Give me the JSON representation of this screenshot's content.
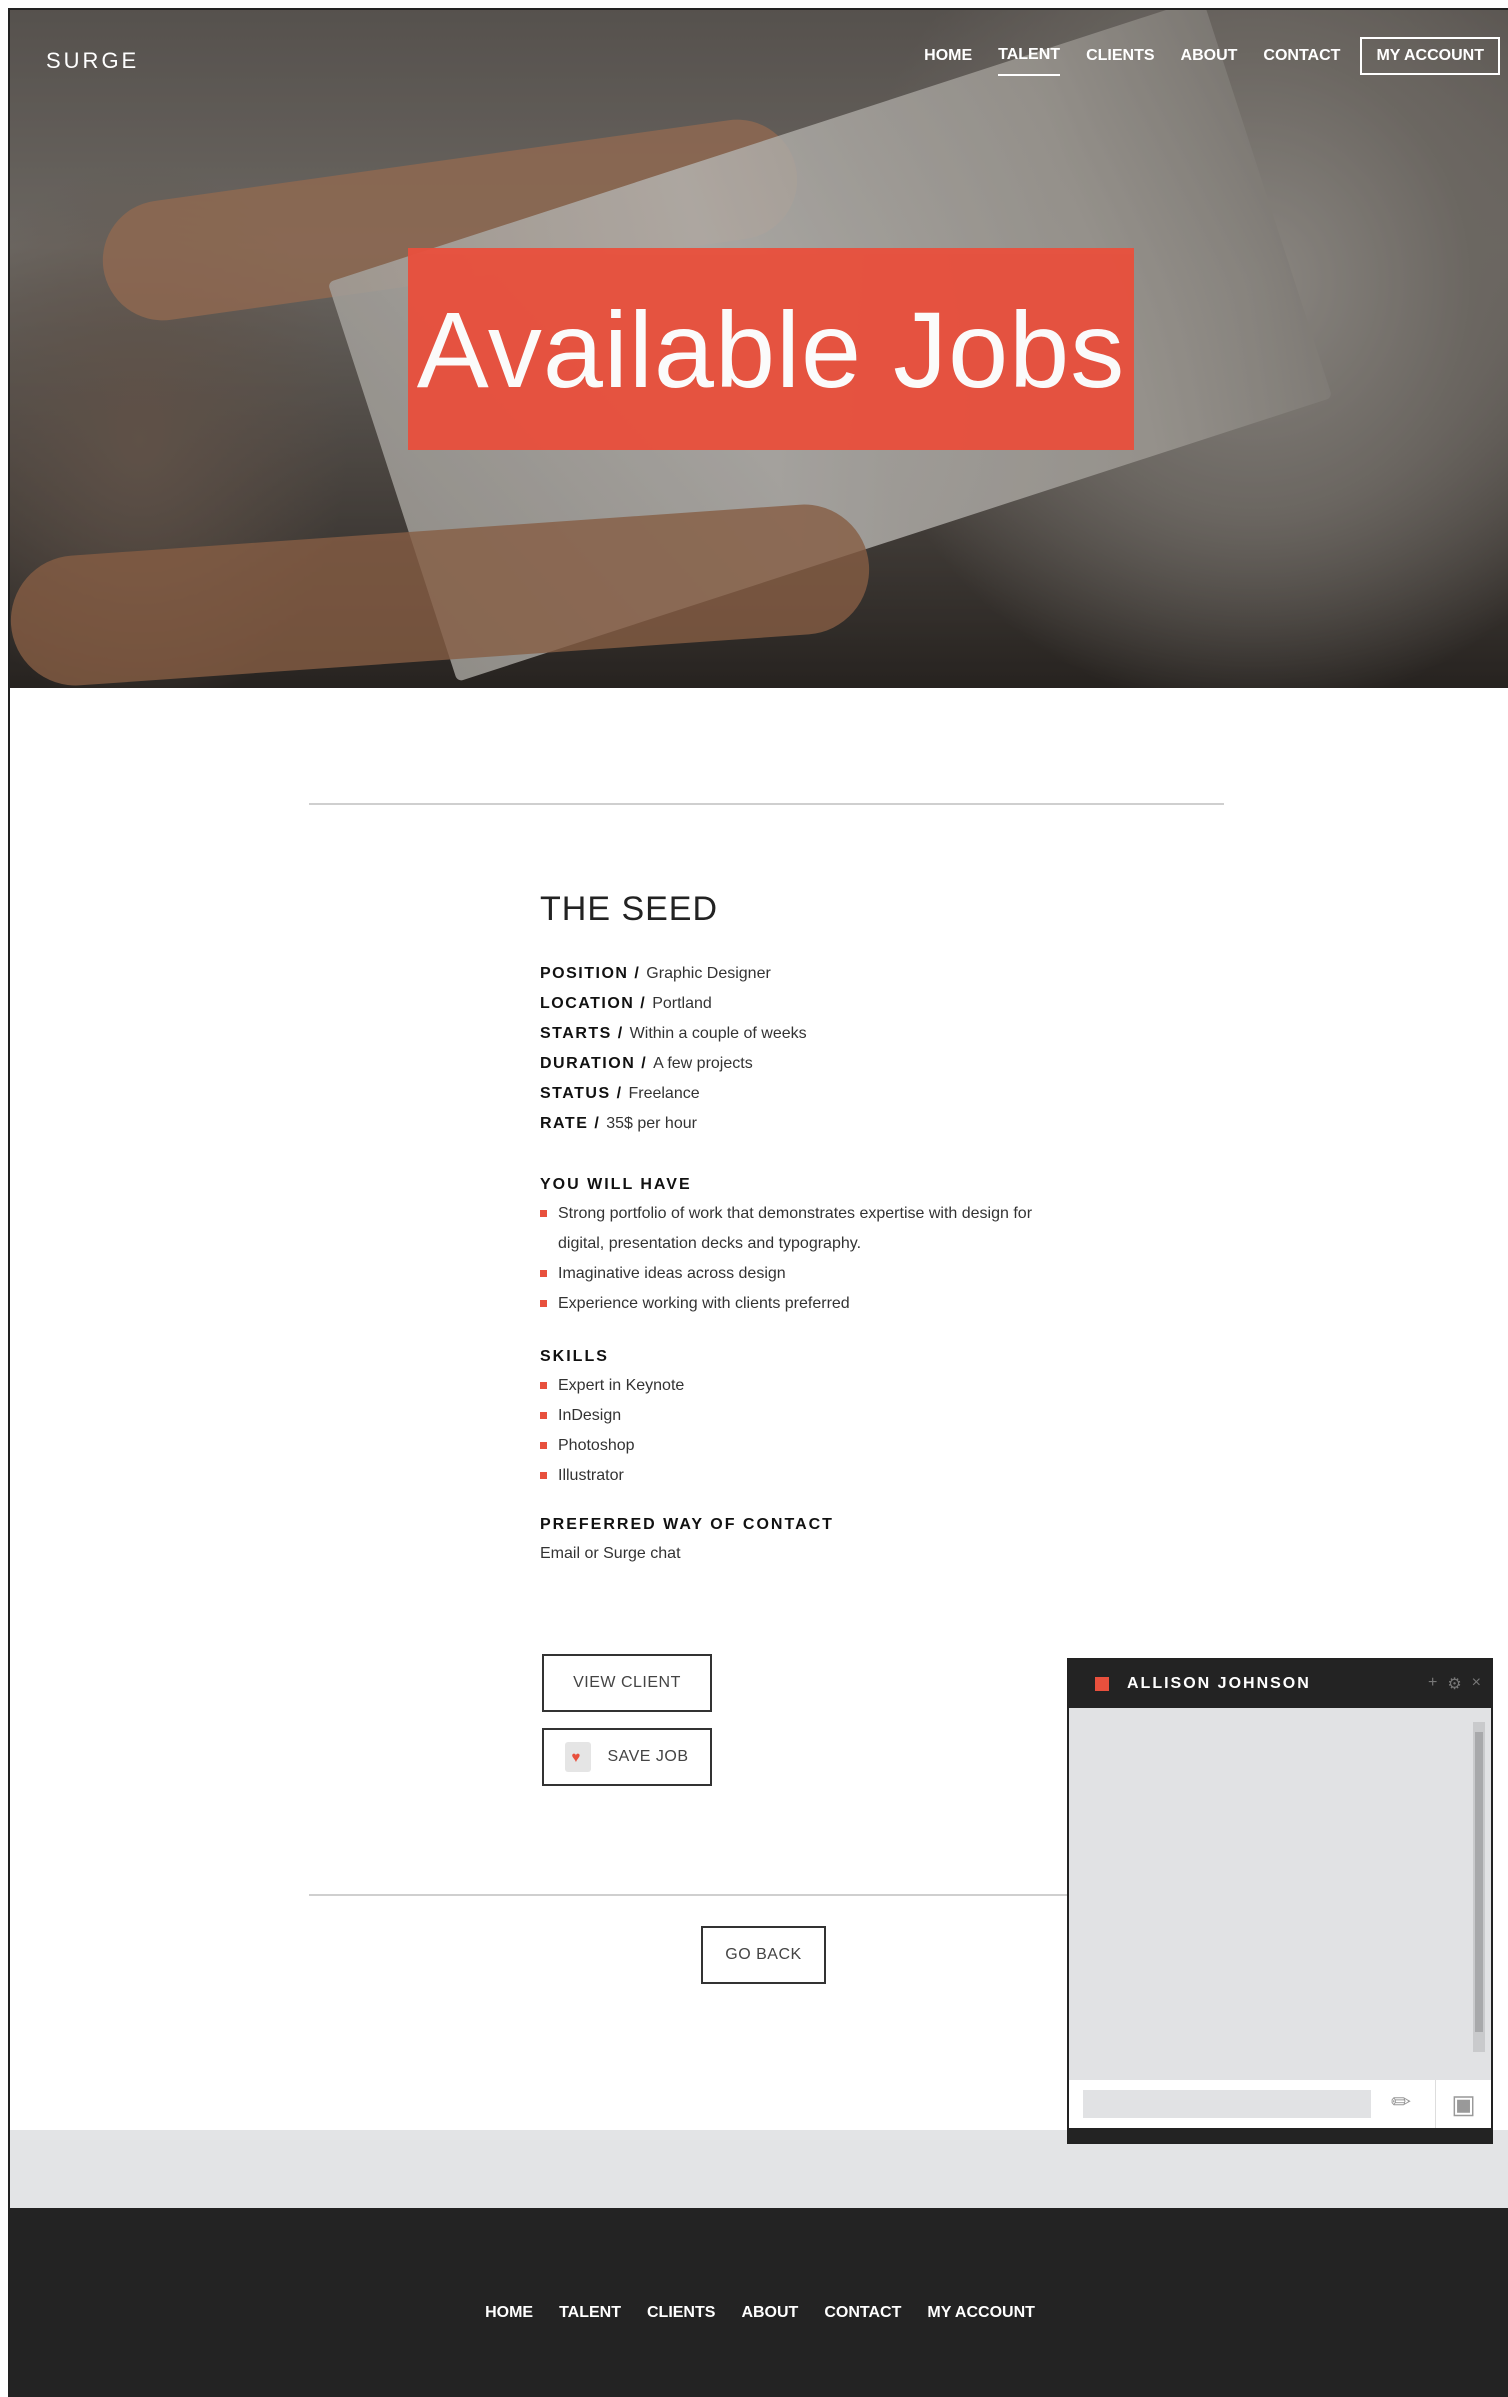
{
  "brand": "SURGE",
  "nav": {
    "items": [
      "HOME",
      "TALENT",
      "CLIENTS",
      "ABOUT",
      "CONTACT"
    ],
    "account": "MY ACCOUNT",
    "active": "TALENT"
  },
  "hero": {
    "title": "Available Jobs"
  },
  "job": {
    "title": "THE SEED",
    "attributes": [
      {
        "label": "POSITION",
        "value": "Graphic Designer"
      },
      {
        "label": "LOCATION",
        "value": "Portland"
      },
      {
        "label": "STARTS",
        "value": "Within a couple of weeks"
      },
      {
        "label": "DURATION",
        "value": "A few projects"
      },
      {
        "label": "STATUS",
        "value": "Freelance"
      },
      {
        "label": "RATE",
        "value": "35$ per hour"
      }
    ],
    "you_will_have": {
      "title": "YOU WILL HAVE",
      "items": [
        "Strong portfolio of work that demonstrates expertise with design for digital, presentation decks and typography.",
        "Imaginative ideas across design",
        "Experience working with clients preferred"
      ]
    },
    "skills": {
      "title": "SKILLS",
      "items": [
        "Expert in Keynote",
        "InDesign",
        "Photoshop",
        "Illustrator"
      ]
    },
    "contact": {
      "title": "PREFERRED WAY OF CONTACT",
      "value": "Email or Surge chat"
    }
  },
  "buttons": {
    "view_client": "VIEW CLIENT",
    "save_job": "SAVE JOB",
    "go_back": "GO BACK"
  },
  "footer": {
    "items": [
      "HOME",
      "TALENT",
      "CLIENTS",
      "ABOUT",
      "CONTACT",
      "MY ACCOUNT"
    ]
  },
  "chat": {
    "name": "ALLISON JOHNSON",
    "controls": [
      "+",
      "⚙",
      "×"
    ],
    "input_value": "",
    "icons": [
      "paperclip-icon",
      "camera-icon"
    ]
  },
  "colors": {
    "accent": "#e8503d",
    "dark": "#232323",
    "band": "#e3e4e6"
  }
}
